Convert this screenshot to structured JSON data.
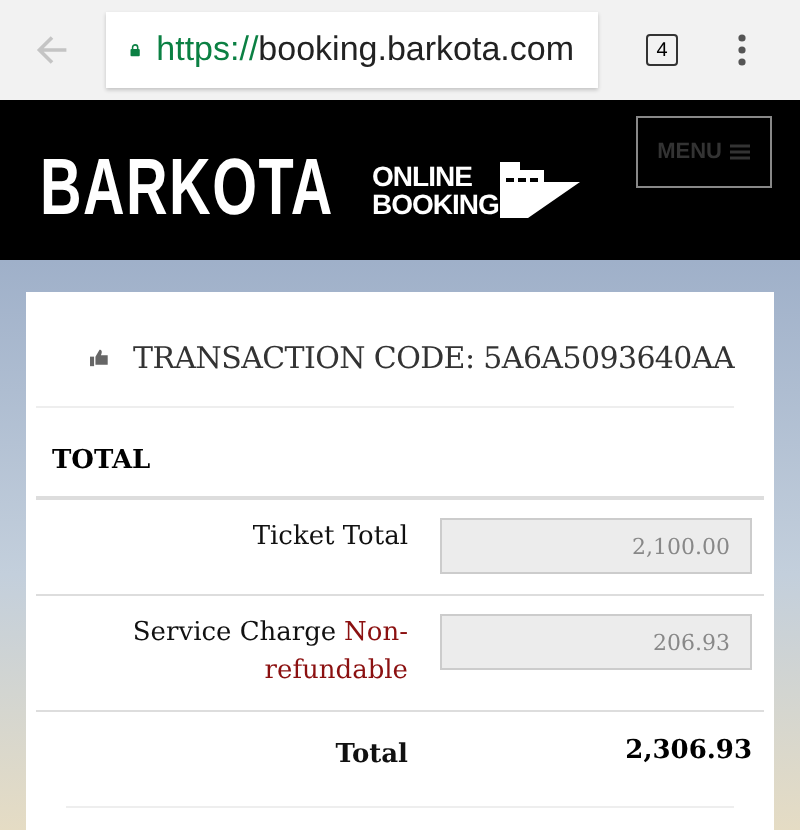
{
  "browser": {
    "url_scheme": "https://",
    "url_host": "booking.barkota.com",
    "tab_count": "4"
  },
  "header": {
    "logo_main": "BARKOTA",
    "logo_top": "ONLINE",
    "logo_bottom": "BOOKING",
    "menu_label": "MENU"
  },
  "transaction": {
    "label": "TRANSACTION CODE:",
    "code": "5A6A5093640AA"
  },
  "section_title": "TOTAL",
  "rows": [
    {
      "kind": "field",
      "label": "Ticket Total",
      "value": "2,100.00"
    },
    {
      "kind": "field",
      "label": "Service Charge",
      "note": "Non-refundable",
      "value": "206.93"
    },
    {
      "kind": "total",
      "label": "Total",
      "value": "2,306.93"
    }
  ]
}
